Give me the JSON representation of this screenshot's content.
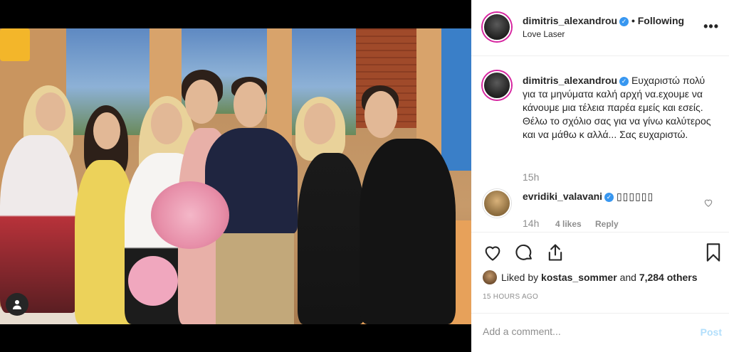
{
  "header": {
    "username": "dimitris_alexandrou",
    "follow_status": "• Following",
    "location": "Love Laser",
    "more_label": "•••"
  },
  "caption": {
    "username": "dimitris_alexandrou",
    "text": "Ευχαριστώ πολύ για τα μηνύματα καλή αρχή να.εχουμε να κάνουμε μια τέλεια παρέα εμείς και εσείς. Θέλω το σχόλιο σας για να γίνω καλύτερος και να μάθω κ αλλά... Σας ευχαριστώ.",
    "time": "15h"
  },
  "comment": {
    "username": "evridiki_valavani",
    "text": "▯▯▯▯▯▯",
    "time": "14h",
    "likes": "4 likes",
    "reply": "Reply"
  },
  "likes": {
    "prefix": "Liked by",
    "user": "kostas_sommer",
    "joiner": "and",
    "others": "7,284 others"
  },
  "posted": "15 HOURS AGO",
  "add_comment": {
    "placeholder": "Add a comment...",
    "post_label": "Post"
  },
  "colors": {
    "verified": "#3897f0",
    "post_disabled": "#b2dffc",
    "muted": "#8e8e8e",
    "text": "#262626"
  }
}
